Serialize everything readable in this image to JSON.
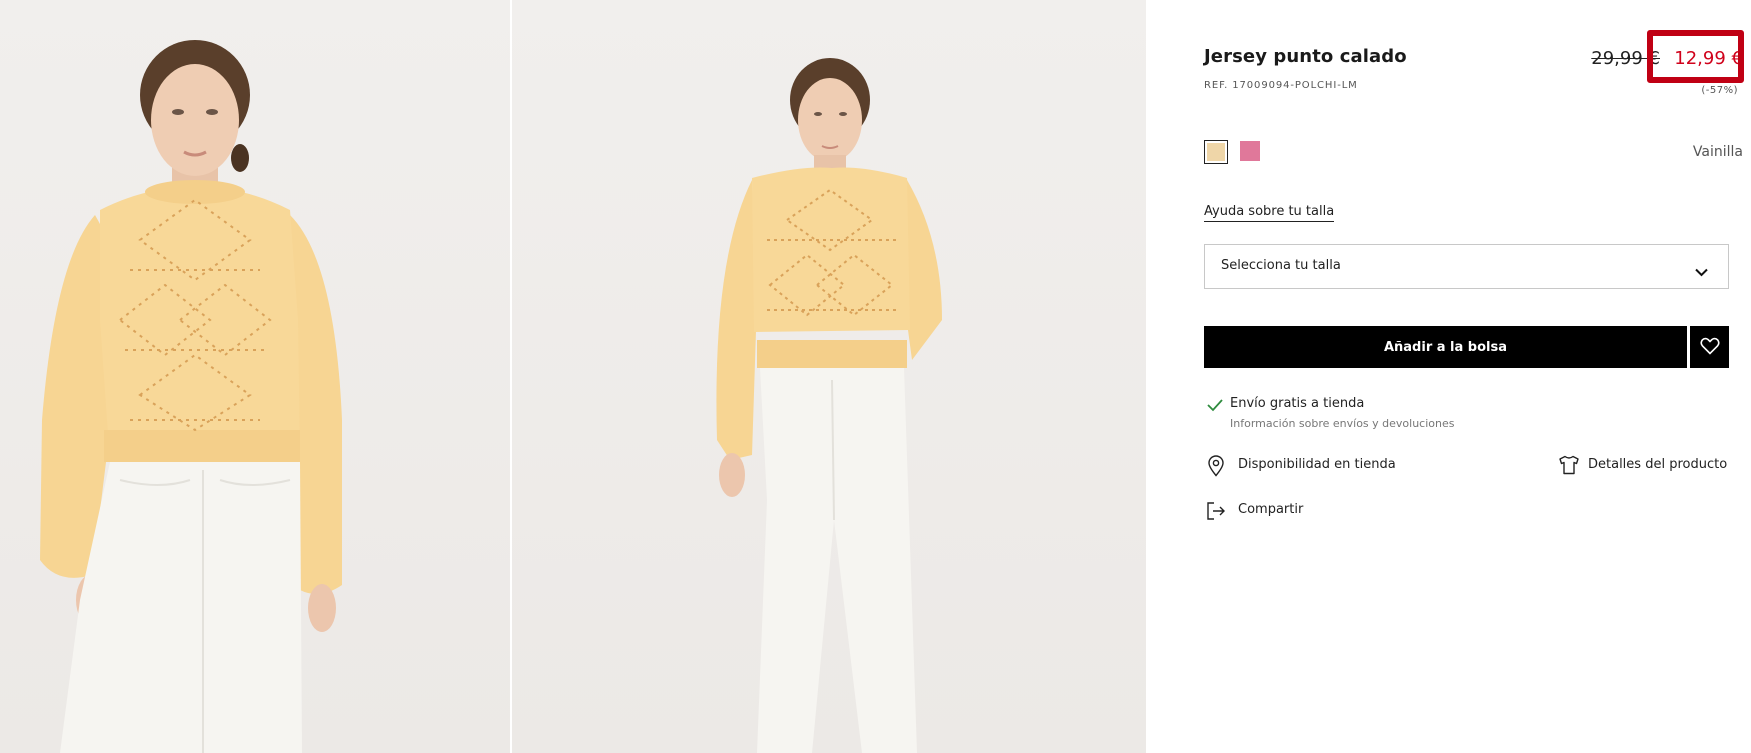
{
  "product": {
    "title": "Jersey punto calado",
    "ref": "REF. 17009094-POLCHI-LM",
    "old_price": "29,99 €",
    "new_price": "12,99 €",
    "discount": "(-57%)",
    "selected_color_name": "Vainilla",
    "colors": [
      {
        "name": "Vainilla",
        "hex": "#efd6a8"
      },
      {
        "name": "Rosa",
        "hex": "#e0789a"
      }
    ]
  },
  "size": {
    "help_link": "Ayuda sobre tu talla",
    "select_placeholder": "Selecciona tu talla"
  },
  "actions": {
    "add_to_bag": "Añadir a la bolsa"
  },
  "info": {
    "shipping_title": "Envío gratis a tienda",
    "shipping_sub": "Información sobre envíos y devoluciones",
    "store_availability": "Disponibilidad en tienda",
    "product_details": "Detalles del producto",
    "share": "Compartir"
  },
  "theme": {
    "price_sale": "#d0021b",
    "highlight": "#c00014",
    "check": "#2e8b3e"
  }
}
